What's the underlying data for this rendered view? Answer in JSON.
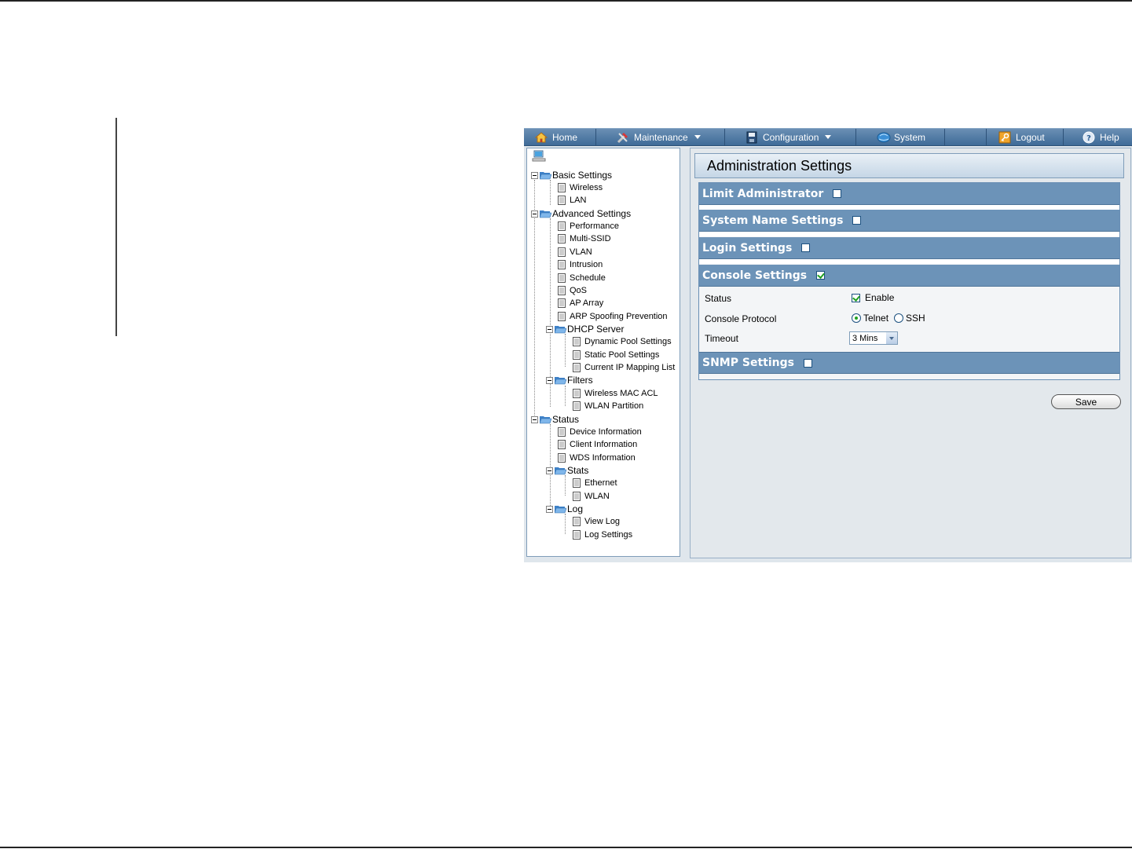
{
  "menu": {
    "home": "Home",
    "maintenance": "Maintenance",
    "configuration": "Configuration",
    "system": "System",
    "logout": "Logout",
    "help": "Help",
    "icons": [
      "home-icon",
      "maintenance-tools-icon",
      "configuration-disk-icon",
      "system-globe-icon",
      "logout-key-icon",
      "help-icon"
    ]
  },
  "tree": {
    "root_icon": "network-computer-icon",
    "basic_settings": "Basic Settings",
    "wireless": "Wireless",
    "lan": "LAN",
    "advanced_settings": "Advanced Settings",
    "performance": "Performance",
    "multi_ssid": "Multi-SSID",
    "vlan": "VLAN",
    "intrusion": "Intrusion",
    "schedule": "Schedule",
    "qos": "QoS",
    "ap_array": "AP Array",
    "arp_spoofing": "ARP Spoofing Prevention",
    "dhcp_server": "DHCP Server",
    "dynamic_pool": "Dynamic Pool Settings",
    "static_pool": "Static Pool Settings",
    "ip_mapping": "Current IP Mapping List",
    "filters": "Filters",
    "wireless_mac_acl": "Wireless MAC ACL",
    "wlan_partition": "WLAN Partition",
    "status": "Status",
    "device_information": "Device Information",
    "client_information": "Client Information",
    "wds_information": "WDS Information",
    "stats": "Stats",
    "ethernet": "Ethernet",
    "wlan": "WLAN",
    "log": "Log",
    "view_log": "View Log",
    "log_settings": "Log Settings"
  },
  "content": {
    "title": "Administration Settings",
    "sections": {
      "limit_admin": "Limit Administrator",
      "system_name": "System Name Settings",
      "login": "Login Settings",
      "console": "Console Settings",
      "snmp": "SNMP Settings"
    },
    "checked": {
      "limit_admin": false,
      "system_name": false,
      "login": false,
      "console": true,
      "snmp": false
    },
    "console": {
      "status_label": "Status",
      "status_enable": "Enable",
      "status_checked": true,
      "protocol_label": "Console Protocol",
      "telnet": "Telnet",
      "ssh": "SSH",
      "protocol_selected": "Telnet",
      "timeout_label": "Timeout",
      "timeout_value": "3 Mins"
    },
    "save": "Save"
  },
  "colors": {
    "menubar": "#4f7ca8",
    "section_header": "#6c93b8",
    "check_accent": "#21a121"
  }
}
